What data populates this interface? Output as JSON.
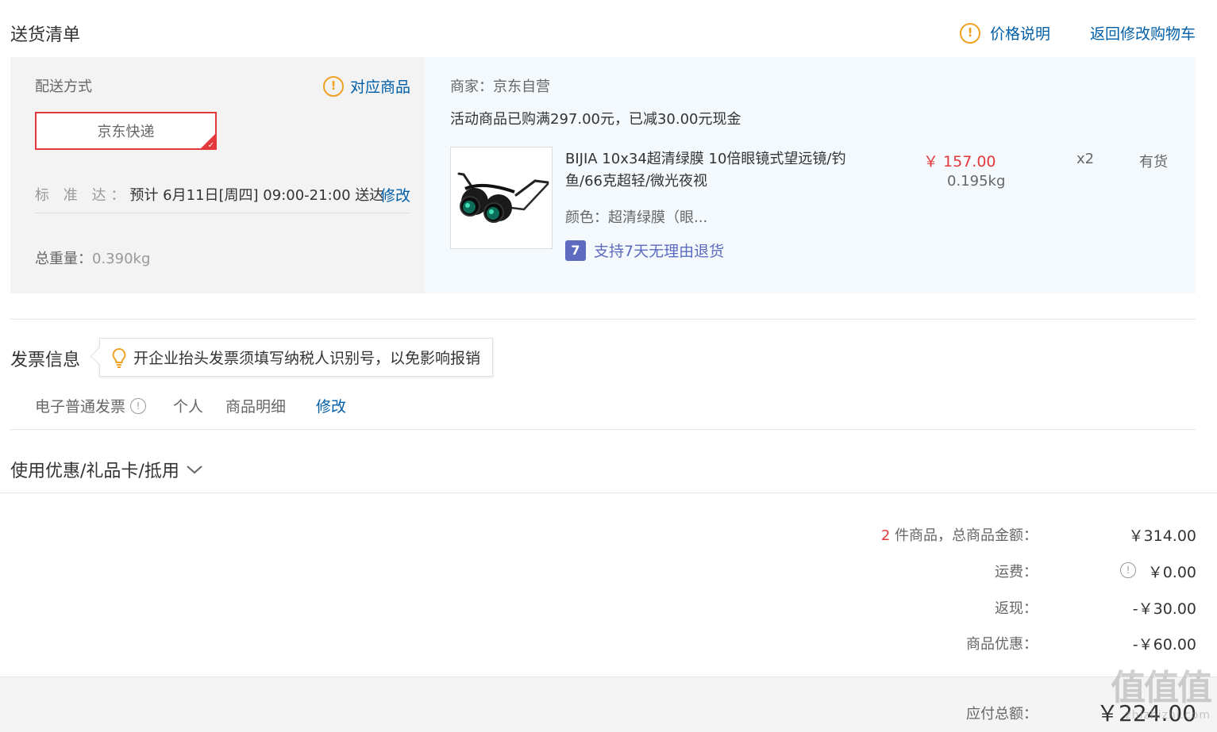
{
  "header": {
    "title": "送货清单",
    "price_info": "价格说明",
    "back_to_cart": "返回修改购物车"
  },
  "shipping": {
    "method_label": "配送方式",
    "matching_products": "对应商品",
    "selected_method": "京东快递",
    "standard_label": "标 准 达：",
    "standard_value": "预计 6月11日[周四] 09:00-21:00 送达",
    "edit": "修改",
    "weight_label": "总重量：",
    "weight_value": "0.390kg"
  },
  "merchant": {
    "label": "商家：京东自营",
    "promo": "活动商品已购满297.00元，已减30.00元现金"
  },
  "product": {
    "name": "BIJIA 10x34超清绿膜 10倍眼镜式望远镜/钓鱼/66克超轻/微光夜视",
    "color": "颜色：超清绿膜（眼...",
    "return_icon": "7",
    "return_policy": "支持7天无理由退货",
    "price": "￥ 157.00",
    "weight": "0.195kg",
    "qty": "x2",
    "stock": "有货"
  },
  "invoice": {
    "title": "发票信息",
    "tip": "开企业抬头发票须填写纳税人识别号，以免影响报销",
    "type": "电子普通发票",
    "holder": "个人",
    "content": "商品明细",
    "edit": "修改"
  },
  "coupon": {
    "title": "使用优惠/礼品卡/抵用"
  },
  "summary": {
    "count": "2",
    "count_suffix": " 件商品，总商品金额：",
    "goods_amount": "￥314.00",
    "shipping_label": "运费：",
    "shipping_value": "￥0.00",
    "cashback_label": "返现：",
    "cashback_value": "-￥30.00",
    "discount_label": "商品优惠：",
    "discount_value": "-￥60.00",
    "total_label": "应付总额：",
    "total_value": "￥224.00"
  },
  "watermark": {
    "text": "值值值",
    "sub": "zhizhizhi.com"
  },
  "colors": {
    "link": "#005ea7",
    "accent_red": "#e4393c",
    "orange": "#ff6600",
    "warn": "#f0a223"
  }
}
